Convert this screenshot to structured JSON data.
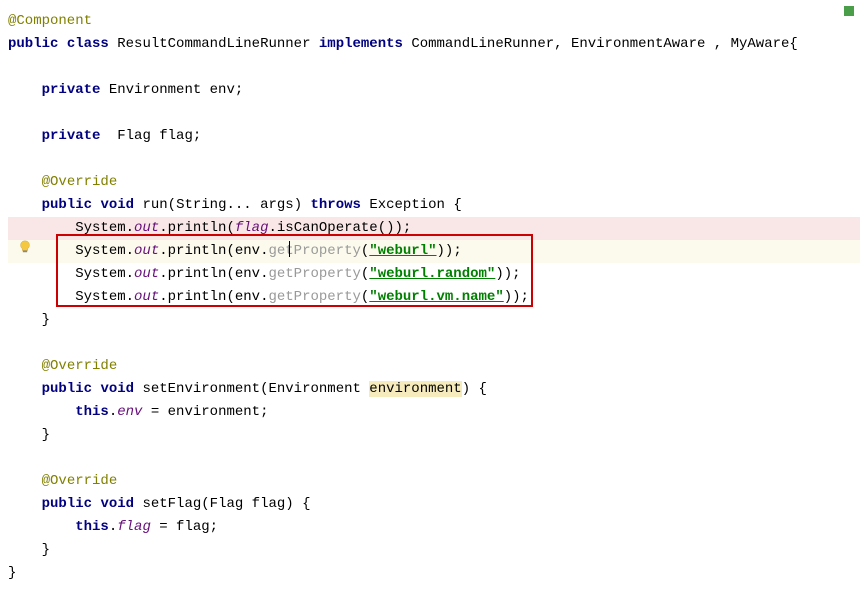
{
  "code": {
    "line1": {
      "annotation": "@Component"
    },
    "line2": {
      "public": "public",
      "class": "class",
      "name": "ResultCommandLineRunner",
      "implements": "implements",
      "impl1": "CommandLineRunner",
      "impl2": "EnvironmentAware",
      "impl3": "MyAware",
      "brace": "{"
    },
    "line4": {
      "private": "private",
      "type": "Environment",
      "name": "env",
      "semi": ";"
    },
    "line6": {
      "private": "private",
      "type": "Flag",
      "name": "flag",
      "semi": ";"
    },
    "line8": {
      "annotation": "@Override"
    },
    "line9": {
      "public": "public",
      "void": "void",
      "name": "run",
      "params": "(String... args)",
      "throws": "throws",
      "exc": "Exception",
      "brace": " {"
    },
    "line10": {
      "prefix": "        System.",
      "out": "out",
      "print": ".println(",
      "flag": "flag",
      "method": ".isCanOperate());"
    },
    "line11": {
      "prefix": "        System.",
      "out": "out",
      "print": ".println(env.",
      "getprop": "getProperty",
      "paren": "(",
      "str": "\"weburl\"",
      "end": "));"
    },
    "line12": {
      "prefix": "        System.",
      "out": "out",
      "print": ".println(env.",
      "getprop": "getProperty",
      "paren": "(",
      "str": "\"weburl.random\"",
      "end": "));"
    },
    "line13": {
      "prefix": "        System.",
      "out": "out",
      "print": ".println(env.",
      "getprop": "getProperty",
      "paren": "(",
      "str": "\"weburl.vm.name\"",
      "end": "));"
    },
    "line14": {
      "brace": "    }"
    },
    "line16": {
      "annotation": "@Override"
    },
    "line17": {
      "public": "public",
      "void": "void",
      "name": "setEnvironment",
      "paren1": "(Environment ",
      "param": "environment",
      "paren2": ")",
      "brace": " {"
    },
    "line18": {
      "this": "this",
      "dot": ".",
      "field": "env",
      "eq": " = environment;"
    },
    "line19": {
      "brace": "    }"
    },
    "line21": {
      "annotation": "@Override"
    },
    "line22": {
      "public": "public",
      "void": "void",
      "name": "setFlag",
      "params": "(Flag flag)",
      "brace": " {"
    },
    "line23": {
      "this": "this",
      "dot": ".",
      "field": "flag",
      "eq": " = flag;"
    },
    "line24": {
      "brace": "    }"
    },
    "line25": {
      "brace": "}"
    }
  }
}
